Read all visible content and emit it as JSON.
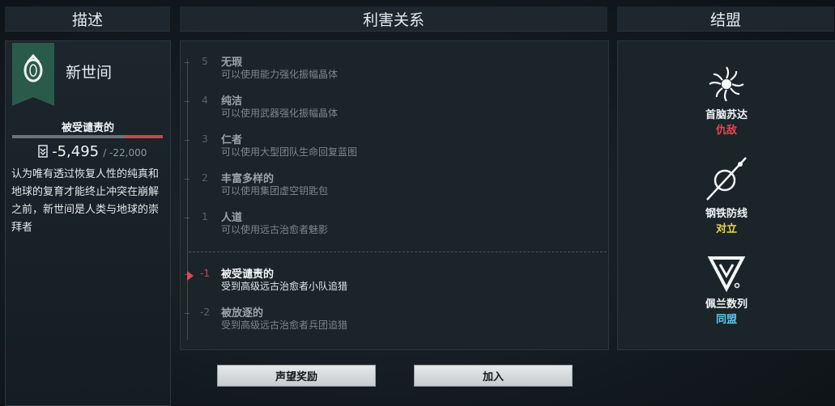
{
  "headers": {
    "description": "描述",
    "relations": "利害关系",
    "alliance": "结盟"
  },
  "faction": {
    "name": "新世间",
    "status": "被受谴责的",
    "reputation": "-5,495",
    "reputation_max": "/ -22,000",
    "reputation_fraction": 0.25,
    "description": "认为唯有透过恢复人性的纯真和地球的复育才能终止冲突在崩解之前，新世间是人类与地球的崇拜者",
    "banner_color": "#2a5a4a",
    "icon": "ring-emblem-icon"
  },
  "tiers": [
    {
      "num": "5",
      "name": "无瑕",
      "requirement": "可以使用能力强化振幅晶体"
    },
    {
      "num": "4",
      "name": "纯洁",
      "requirement": "可以使用武器强化振幅晶体"
    },
    {
      "num": "3",
      "name": "仁者",
      "requirement": "可以使用大型团队生命回复蓝图"
    },
    {
      "num": "2",
      "name": "丰富多样的",
      "requirement": "可以使用集团虚空钥匙包"
    },
    {
      "num": "1",
      "name": "人道",
      "requirement": "可以使用远古治愈者魅影"
    },
    {
      "num": "-1",
      "name": "被受谴责的",
      "requirement": "受到高级远古治愈者小队追猎",
      "active": true
    },
    {
      "num": "-2",
      "name": "被放逐的",
      "requirement": "受到高级远古治愈者兵团追猎"
    }
  ],
  "alliances": [
    {
      "name": "首脑苏达",
      "status": "仇敌",
      "status_color": "#e5474d",
      "icon": "sunburst-icon"
    },
    {
      "name": "钢铁防线",
      "status": "对立",
      "status_color": "#f0d44a",
      "icon": "circle-slash-icon"
    },
    {
      "name": "佩兰数列",
      "status": "同盟",
      "status_color": "#5cc6ee",
      "icon": "triangle-emblem-icon"
    }
  ],
  "buttons": {
    "rewards": "声望奖励",
    "join": "加入"
  }
}
